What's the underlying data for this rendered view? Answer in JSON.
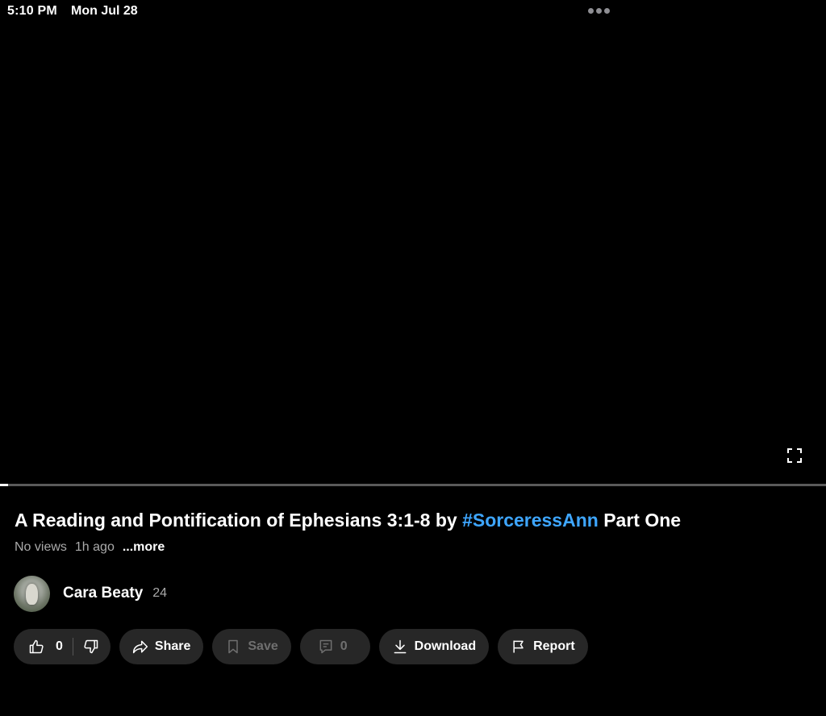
{
  "status_bar": {
    "time": "5:10 PM",
    "date": "Mon Jul 28"
  },
  "video": {
    "progress": 0.01,
    "title_prefix": "A Reading and Pontification of Ephesians 3:1-8 by ",
    "title_hashtag": "#SorceressAnn",
    "title_suffix": " Part One",
    "views": "No views",
    "age": "1h ago",
    "more_label": "...more"
  },
  "channel": {
    "name": "Cara Beaty",
    "subscribers": "24"
  },
  "actions": {
    "like_count": "0",
    "share_label": "Share",
    "save_label": "Save",
    "comment_count": "0",
    "download_label": "Download",
    "report_label": "Report"
  },
  "colors": {
    "background": "#000000",
    "pill": "#272727",
    "hashtag": "#3ea6ff",
    "meta_text": "#aaaaaa"
  },
  "icons": [
    "multitask-dots-icon",
    "fullscreen-icon",
    "thumbs-up-icon",
    "thumbs-down-icon",
    "share-icon",
    "bookmark-icon",
    "comment-icon",
    "download-icon",
    "flag-icon"
  ]
}
